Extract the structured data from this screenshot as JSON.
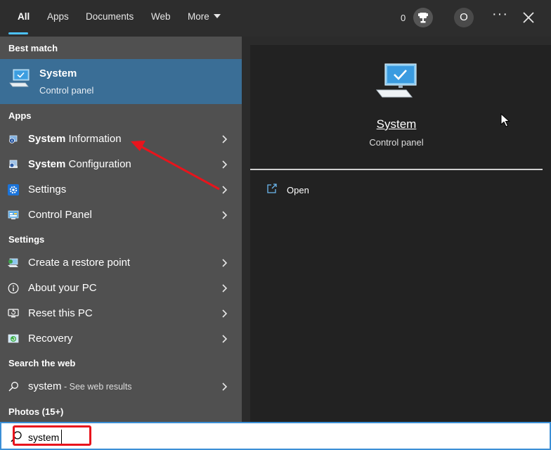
{
  "tabs": [
    {
      "label": "All",
      "active": true
    },
    {
      "label": "Apps"
    },
    {
      "label": "Documents"
    },
    {
      "label": "Web"
    },
    {
      "label": "More"
    }
  ],
  "header": {
    "points": "0",
    "avatar_initial": "O",
    "more_icon": "ellipsis-icon",
    "close_icon": "close-icon",
    "trophy_icon": "trophy-icon"
  },
  "sections": {
    "best_match": "Best match",
    "apps": "Apps",
    "settings": "Settings",
    "search_web": "Search the web",
    "photos": "Photos (15+)"
  },
  "best_match": {
    "title": "System",
    "subtitle": "Control panel",
    "icon": "computer-icon"
  },
  "apps": [
    {
      "bold": "System",
      "rest": " Information",
      "icon": "system-information-icon"
    },
    {
      "bold": "System",
      "rest": " Configuration",
      "icon": "system-configuration-icon"
    },
    {
      "bold": "",
      "rest": "Settings",
      "icon": "gear-icon"
    },
    {
      "bold": "",
      "rest": "Control Panel",
      "icon": "control-panel-icon"
    }
  ],
  "settings": [
    {
      "label": "Create a restore point",
      "icon": "restore-point-icon"
    },
    {
      "label": "About your PC",
      "icon": "info-icon"
    },
    {
      "label": "Reset this PC",
      "icon": "reset-icon"
    },
    {
      "label": "Recovery",
      "icon": "recovery-icon"
    }
  ],
  "web": {
    "query": "system",
    "hint": " - See web results",
    "icon": "search-icon"
  },
  "detail": {
    "title": "System",
    "subtitle": "Control panel",
    "open_label": "Open",
    "open_icon": "open-icon"
  },
  "search": {
    "value": "system",
    "placeholder": ""
  },
  "colors": {
    "accent": "#4cc2ff",
    "selected": "#3a6e96",
    "annotation": "#e8141c"
  }
}
